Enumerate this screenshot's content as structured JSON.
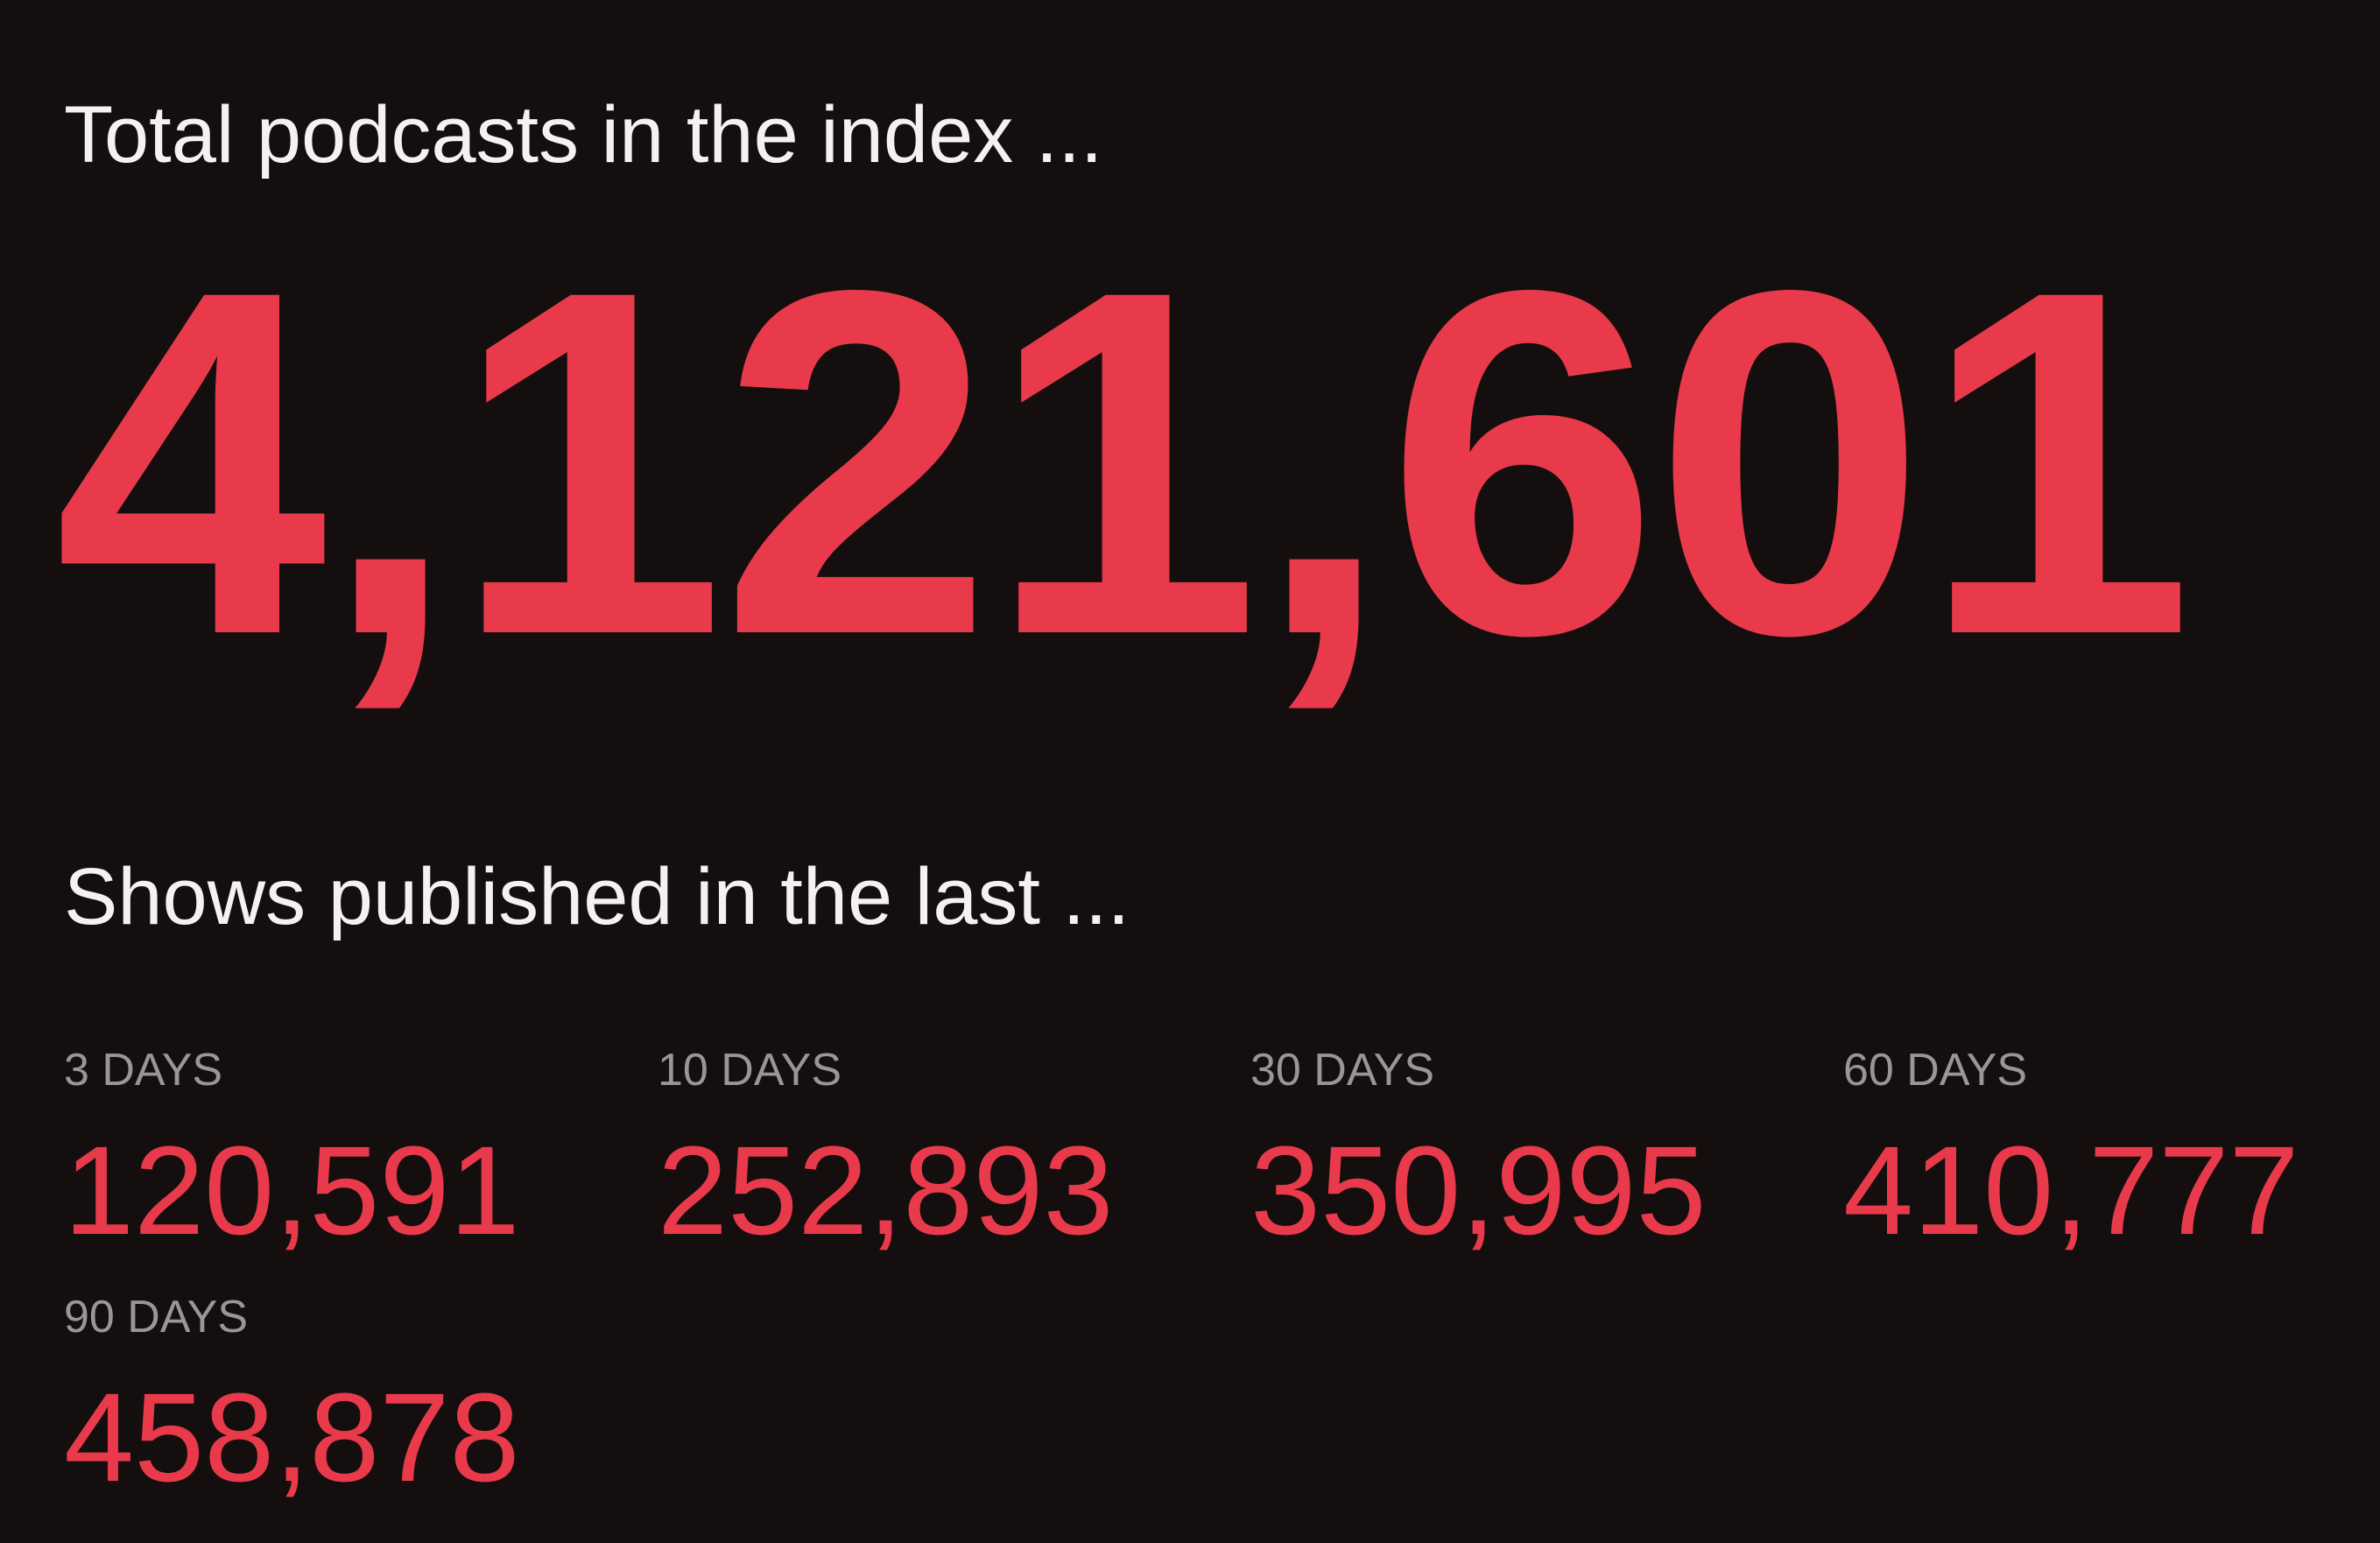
{
  "total": {
    "heading": "Total podcasts in the index ...",
    "count": "4,121,601"
  },
  "recent": {
    "heading": "Shows published in the last ...",
    "stats": [
      {
        "label": "3 DAYS",
        "value": "120,591"
      },
      {
        "label": "10 DAYS",
        "value": "252,893"
      },
      {
        "label": "30 DAYS",
        "value": "350,995"
      },
      {
        "label": "60 DAYS",
        "value": "410,777"
      },
      {
        "label": "90 DAYS",
        "value": "458,878"
      }
    ]
  },
  "colors": {
    "background": "#140e0e",
    "accent": "#e83a4a",
    "heading_text": "#f4f1f1",
    "label_text": "#9b9595"
  }
}
